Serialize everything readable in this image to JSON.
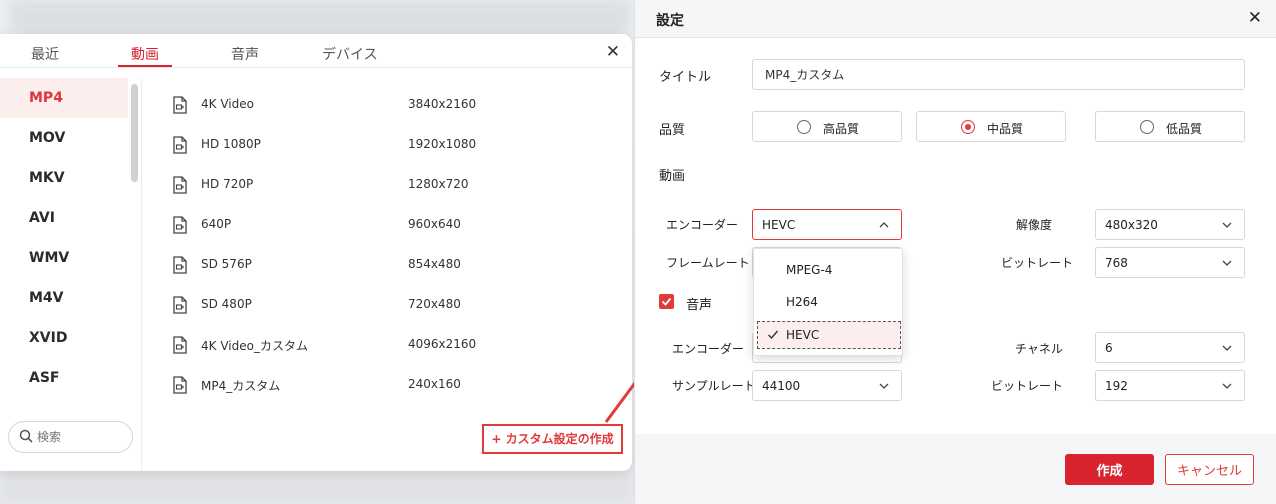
{
  "converter": {
    "tabs": [
      {
        "label": "最近"
      },
      {
        "label": "動画"
      },
      {
        "label": "音声"
      },
      {
        "label": "デバイス"
      }
    ],
    "active_tab": "動画",
    "formats": [
      {
        "label": "MP4"
      },
      {
        "label": "MOV"
      },
      {
        "label": "MKV"
      },
      {
        "label": "AVI"
      },
      {
        "label": "WMV"
      },
      {
        "label": "M4V"
      },
      {
        "label": "XVID"
      },
      {
        "label": "ASF"
      }
    ],
    "active_format": "MP4",
    "search_placeholder": "検索",
    "presets": [
      {
        "name": "4K Video",
        "resolution": "3840x2160"
      },
      {
        "name": "HD 1080P",
        "resolution": "1920x1080"
      },
      {
        "name": "HD 720P",
        "resolution": "1280x720"
      },
      {
        "name": "640P",
        "resolution": "960x640"
      },
      {
        "name": "SD 576P",
        "resolution": "854x480"
      },
      {
        "name": "SD 480P",
        "resolution": "720x480"
      },
      {
        "name": "4K Video_カスタム",
        "resolution": "4096x2160"
      },
      {
        "name": "MP4_カスタム",
        "resolution": "240x160"
      }
    ],
    "create_custom_label": "+ カスタム設定の作成"
  },
  "settings": {
    "title": "設定",
    "title_label": "タイトル",
    "title_value": "MP4_カスタム",
    "quality_label": "品質",
    "quality_options": [
      {
        "label": "高品質",
        "selected": false
      },
      {
        "label": "中品質",
        "selected": true
      },
      {
        "label": "低品質",
        "selected": false
      }
    ],
    "video_section": "動画",
    "video": {
      "encoder_label": "エンコーダー",
      "encoder_value": "HEVC",
      "encoder_options": [
        {
          "label": "MPEG-4",
          "selected": false
        },
        {
          "label": "H264",
          "selected": false
        },
        {
          "label": "HEVC",
          "selected": true
        }
      ],
      "resolution_label": "解像度",
      "resolution_value": "480x320",
      "framerate_label": "フレームレート",
      "bitrate_label": "ビットレート",
      "bitrate_value": "768"
    },
    "audio_section": "音声",
    "audio_enabled": true,
    "audio": {
      "encoder_label": "エンコーダー",
      "channel_label": "チャネル",
      "channel_value": "6",
      "samplerate_label": "サンプルレート",
      "samplerate_value": "44100",
      "bitrate_label": "ビットレート",
      "bitrate_value": "192"
    },
    "create_button": "作成",
    "cancel_button": "キャンセル"
  },
  "colors": {
    "accent": "#d9232e",
    "active_bg": "#fdeeee"
  }
}
